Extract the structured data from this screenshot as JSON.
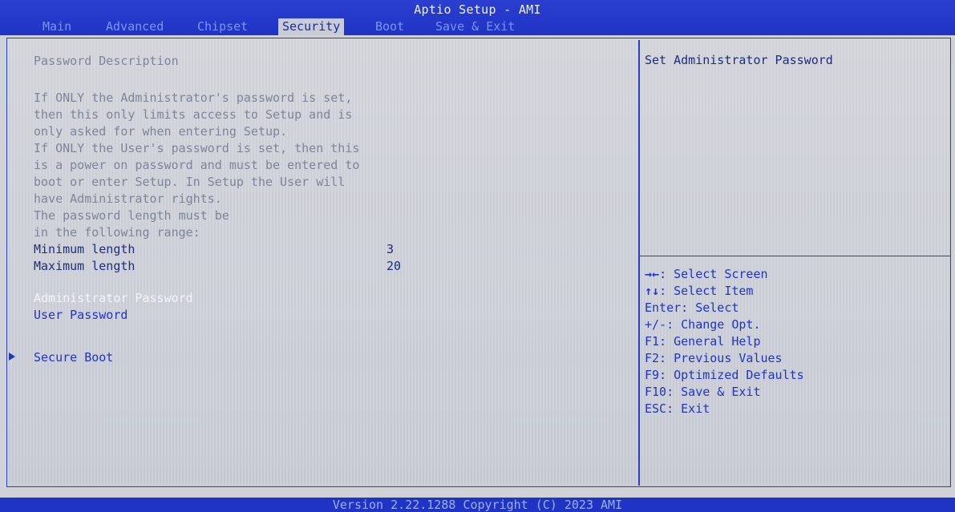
{
  "app": {
    "title": "Aptio Setup - AMI"
  },
  "tabs": [
    {
      "label": "Main"
    },
    {
      "label": "Advanced"
    },
    {
      "label": "Chipset"
    },
    {
      "label": "Security"
    },
    {
      "label": "Boot"
    },
    {
      "label": "Save & Exit"
    }
  ],
  "main": {
    "heading": "Password Description",
    "description": [
      "If ONLY the Administrator's password is set,",
      "then this only limits access to Setup and is",
      "only asked for when entering Setup.",
      "If ONLY the User's password is set, then this",
      "is a power on password and must be entered to",
      "boot or enter Setup. In Setup the User will",
      "have Administrator rights.",
      "The password length must be",
      "in the following range:"
    ],
    "min_label": "Minimum length",
    "min_value": "3",
    "max_label": "Maximum length",
    "max_value": "20",
    "admin_password": "Administrator Password",
    "user_password": "User Password",
    "secure_boot": "Secure Boot"
  },
  "help": {
    "title": "Set Administrator Password",
    "keys": [
      {
        "glyph": "→←",
        "text": ": Select Screen"
      },
      {
        "glyph": "↑↓",
        "text": ": Select Item"
      },
      {
        "glyph": "",
        "text": "Enter: Select"
      },
      {
        "glyph": "",
        "text": "+/-: Change Opt."
      },
      {
        "glyph": "",
        "text": "F1: General Help"
      },
      {
        "glyph": "",
        "text": "F2: Previous Values"
      },
      {
        "glyph": "",
        "text": "F9: Optimized Defaults"
      },
      {
        "glyph": "",
        "text": "F10: Save & Exit"
      },
      {
        "glyph": "",
        "text": "ESC: Exit"
      }
    ]
  },
  "footer": {
    "text": "Version 2.22.1288 Copyright (C) 2023 AMI"
  },
  "colors": {
    "accent_blue": "#1f33c4",
    "panel_gray": "#cfd2d9",
    "highlight_text": "#f4f5fb"
  }
}
